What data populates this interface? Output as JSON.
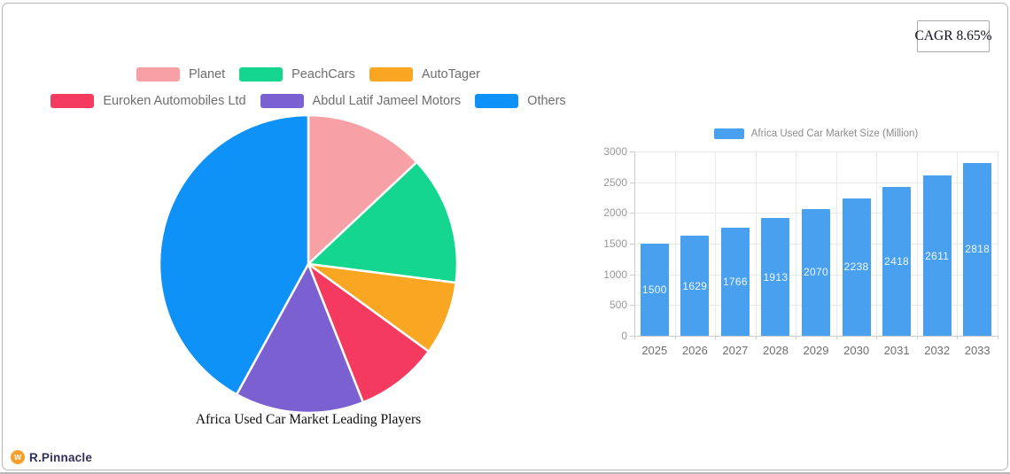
{
  "cagr_badge": "CAGR 8.65%",
  "brand": {
    "name": "R.Pinnacle",
    "icon": "pinnacle-logo",
    "icon_color": "#f7a02b"
  },
  "colors": {
    "bar_fill": "#49a0ee",
    "grid": "#e9e9e9",
    "axis": "#cccccc",
    "legend_text": "#6e6e6e",
    "y_axis_text": "#999999",
    "x_axis_text": "#6e6e6e",
    "card_border": "#b5b5b5"
  },
  "chart_data": [
    {
      "type": "pie",
      "title": "Africa Used Car Market Leading Players",
      "start_angle_deg": 0,
      "direction": "clockwise",
      "slices": [
        {
          "label": "Planet",
          "percent": 13,
          "color": "#f7a1a7"
        },
        {
          "label": "PeachCars",
          "percent": 14,
          "color": "#14d68e"
        },
        {
          "label": "AutoTager",
          "percent": 8,
          "color": "#f9a623"
        },
        {
          "label": "Euroken Automobiles Ltd",
          "percent": 9,
          "color": "#f43b5f"
        },
        {
          "label": "Abdul Latif Jameel Motors",
          "percent": 14,
          "color": "#7b60d1"
        },
        {
          "label": "Others",
          "percent": 42,
          "color": "#0e92f8"
        }
      ],
      "legend_rows": [
        [
          0,
          1,
          2
        ],
        [
          3,
          4,
          5
        ]
      ]
    },
    {
      "type": "bar",
      "series_label": "Africa Used Car Market Size (Million)",
      "categories": [
        "2025",
        "2026",
        "2027",
        "2028",
        "2029",
        "2030",
        "2031",
        "2032",
        "2033"
      ],
      "values": [
        1500,
        1629,
        1766,
        1913,
        2070,
        2238,
        2418,
        2611,
        2818
      ],
      "ylim": [
        0,
        3000
      ],
      "yticks": [
        0,
        500,
        1000,
        1500,
        2000,
        2500,
        3000
      ],
      "bar_color": "#49a0ee",
      "value_label_color": "#ffffff",
      "legend_position": "top",
      "grid": true
    }
  ]
}
